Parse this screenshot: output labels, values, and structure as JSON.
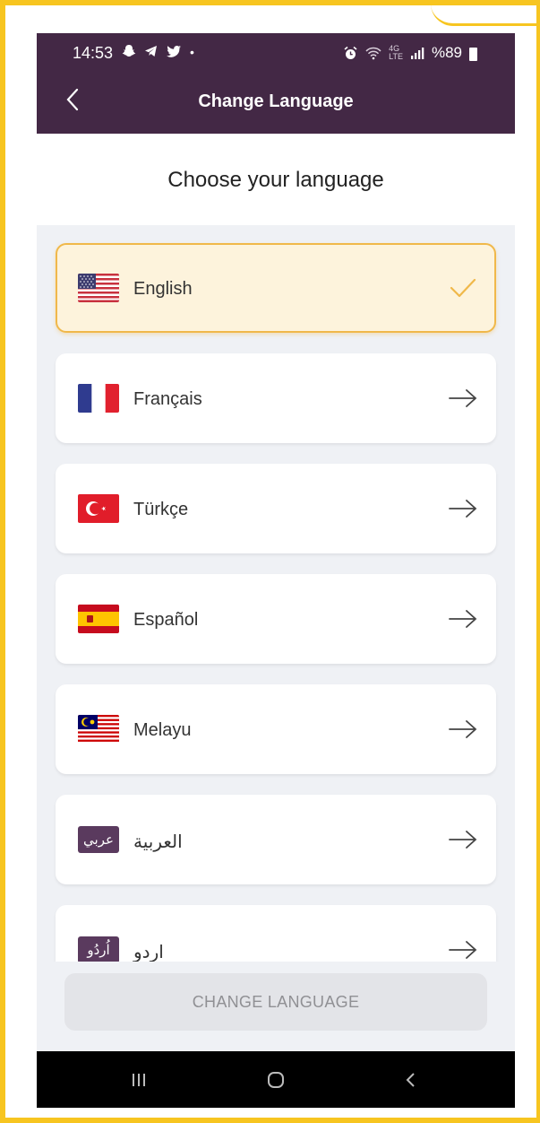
{
  "status_bar": {
    "time": "14:53",
    "left_icons": [
      "snapchat-icon",
      "telegram-icon",
      "twitter-icon",
      "dot-icon"
    ],
    "right_icons": [
      "alarm-icon",
      "wifi-icon",
      "4g-icon",
      "signal-icon"
    ],
    "battery": "%89"
  },
  "app_bar": {
    "back_icon": "chevron-left-icon",
    "title": "Change Language"
  },
  "page": {
    "title": "Choose your language"
  },
  "languages": [
    {
      "label": "English",
      "flag": "us-flag-icon",
      "selected": true,
      "action_icon": "check-icon"
    },
    {
      "label": "Français",
      "flag": "france-flag-icon",
      "selected": false,
      "action_icon": "arrow-right-icon"
    },
    {
      "label": "Türkçe",
      "flag": "turkey-flag-icon",
      "selected": false,
      "action_icon": "arrow-right-icon"
    },
    {
      "label": "Español",
      "flag": "spain-flag-icon",
      "selected": false,
      "action_icon": "arrow-right-icon"
    },
    {
      "label": "Melayu",
      "flag": "malaysia-flag-icon",
      "selected": false,
      "action_icon": "arrow-right-icon"
    },
    {
      "label": "العربية",
      "flag": "arabic-badge-icon",
      "badge_text": "عربي",
      "selected": false,
      "action_icon": "arrow-right-icon"
    },
    {
      "label": "اردو",
      "flag": "urdu-badge-icon",
      "badge_text": "اُردُو",
      "selected": false,
      "action_icon": "arrow-right-icon"
    }
  ],
  "cta": {
    "label": "CHANGE LANGUAGE",
    "enabled": false
  },
  "nav_bar": {
    "buttons": [
      "recents-icon",
      "home-icon",
      "back-icon"
    ]
  },
  "colors": {
    "header": "#432845",
    "frame": "#f7c520",
    "selected_border": "#f0b84a",
    "selected_bg": "#fdf3dc",
    "list_bg": "#eff1f5"
  }
}
